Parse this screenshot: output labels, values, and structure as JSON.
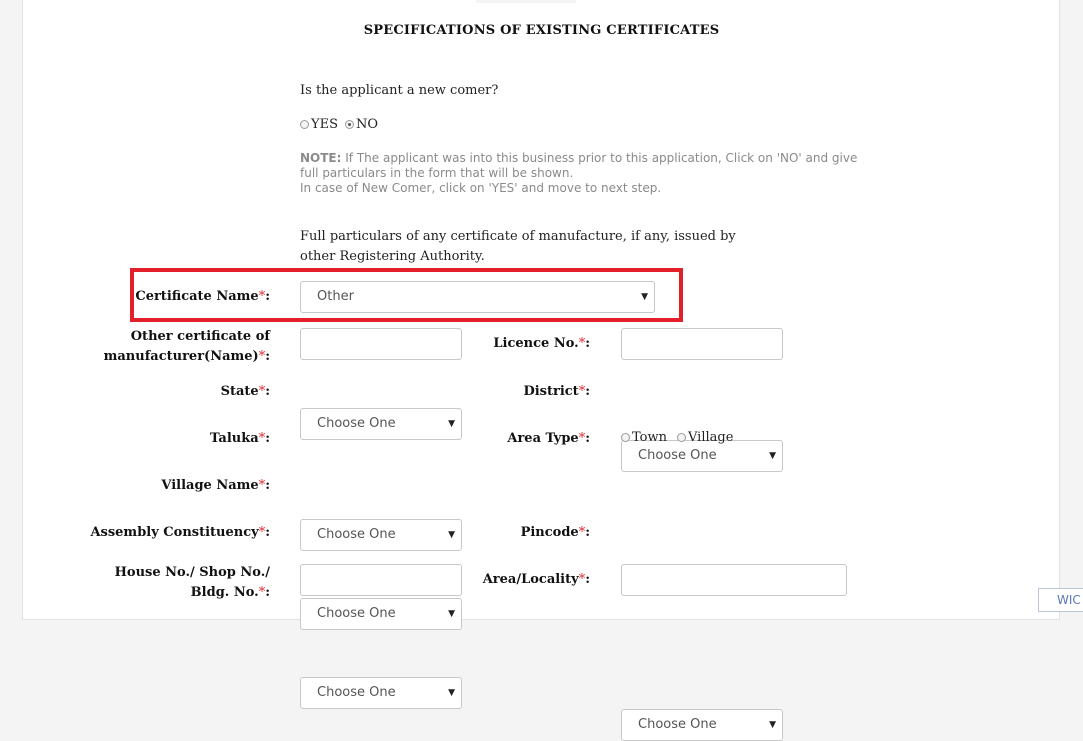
{
  "section_title": "SPECIFICATIONS OF EXISTING CERTIFICATES",
  "newcomer": {
    "question": "Is the applicant a new comer?",
    "yes_label": "YES",
    "no_label": "NO",
    "selected": "NO"
  },
  "note": {
    "prefix": "NOTE:",
    "line1": " If The applicant was into this business prior to this application, Click on 'NO' and give full particulars in the form that will be shown.",
    "line2": "In case of New Comer, click on 'YES' and move to next step."
  },
  "particulars_text": "Full particulars of any certificate of manufacture, if any, issued by other Registering Authority.",
  "required_mark": "*",
  "colon": ":",
  "fields": {
    "certificate_name": {
      "label": "Certificate Name",
      "value": "Other"
    },
    "other_certificate": {
      "label_line1": "Other certificate of",
      "label_line2": "manufacturer(Name)",
      "value": ""
    },
    "licence_no": {
      "label": "Licence No.",
      "value": ""
    },
    "state": {
      "label": "State",
      "value": "Choose One"
    },
    "district": {
      "label": "District",
      "value": "Choose One"
    },
    "taluka": {
      "label": "Taluka",
      "value": "Choose One"
    },
    "area_type": {
      "label": "Area Type",
      "options": [
        "Town",
        "Village"
      ]
    },
    "village_name": {
      "label": "Village Name",
      "value": "Choose One"
    },
    "assembly_constituency": {
      "label": "Assembly Constituency",
      "value": "Choose One"
    },
    "pincode": {
      "label": "Pincode",
      "value": "Choose One"
    },
    "house_no": {
      "label_line1": "House No./ Shop No./",
      "label_line2": "Bldg. No.",
      "value": ""
    },
    "area_locality": {
      "label": "Area/Locality",
      "value": ""
    }
  },
  "corner_widget": "WIC",
  "colors": {
    "highlight": "#e3202a",
    "required": "#e0282f",
    "note": "#8a8a8a"
  }
}
